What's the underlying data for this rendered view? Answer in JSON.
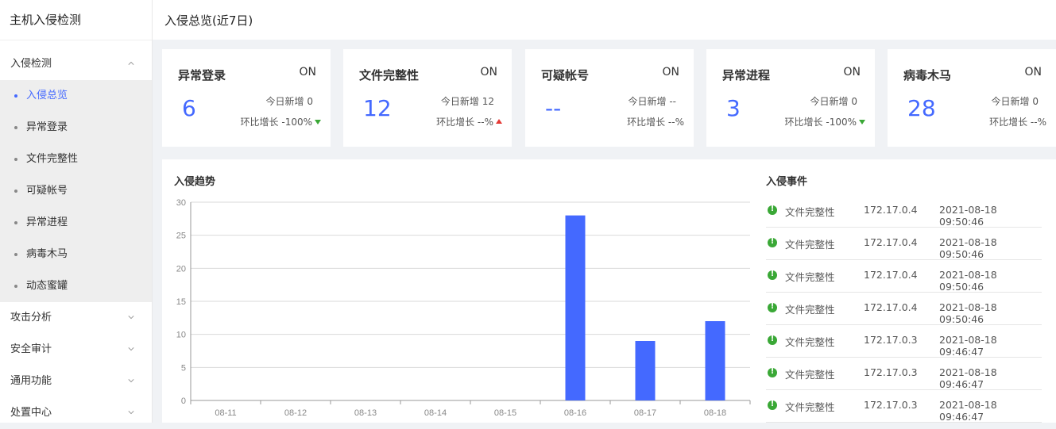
{
  "app": {
    "title": "主机入侵检测"
  },
  "header": {
    "title": "入侵总览(近7日)"
  },
  "sidebar": {
    "groups": [
      {
        "label": "入侵检测",
        "expanded": true
      },
      {
        "label": "攻击分析"
      },
      {
        "label": "安全审计"
      },
      {
        "label": "通用功能"
      },
      {
        "label": "处置中心"
      }
    ],
    "sub_items": [
      {
        "label": "入侵总览",
        "active": true
      },
      {
        "label": "异常登录"
      },
      {
        "label": "文件完整性"
      },
      {
        "label": "可疑帐号"
      },
      {
        "label": "异常进程"
      },
      {
        "label": "病毒木马"
      },
      {
        "label": "动态蜜罐"
      }
    ]
  },
  "cards": [
    {
      "title": "异常登录",
      "status": "ON",
      "value": "6",
      "today": "今日新增 0",
      "ratio": "环比增长 -100%",
      "trend": "down"
    },
    {
      "title": "文件完整性",
      "status": "ON",
      "value": "12",
      "today": "今日新增 12",
      "ratio": "环比增长 --%",
      "trend": "up"
    },
    {
      "title": "可疑帐号",
      "status": "ON",
      "value": "--",
      "today": "今日新增 --",
      "ratio": "环比增长 --%",
      "trend": "none"
    },
    {
      "title": "异常进程",
      "status": "ON",
      "value": "3",
      "today": "今日新增 0",
      "ratio": "环比增长 -100%",
      "trend": "down"
    },
    {
      "title": "病毒木马",
      "status": "ON",
      "value": "28",
      "today": "今日新增 0",
      "ratio": "环比增长 --%",
      "trend": "none"
    }
  ],
  "trend_chart": {
    "title": "入侵趋势"
  },
  "chart_data": {
    "type": "bar",
    "title": "入侵趋势",
    "categories": [
      "08-11",
      "08-12",
      "08-13",
      "08-14",
      "08-15",
      "08-16",
      "08-17",
      "08-18"
    ],
    "values": [
      0,
      0,
      0,
      0,
      0,
      28,
      9,
      12
    ],
    "ylim": [
      0,
      30
    ],
    "yticks": [
      0,
      5,
      10,
      15,
      20,
      25,
      30
    ],
    "grid": true,
    "bar_color": "#4469ff"
  },
  "events": {
    "title": "入侵事件",
    "rows": [
      {
        "type": "文件完整性",
        "ip": "172.17.0.4",
        "time": "2021-08-18 09:50:46"
      },
      {
        "type": "文件完整性",
        "ip": "172.17.0.4",
        "time": "2021-08-18 09:50:46"
      },
      {
        "type": "文件完整性",
        "ip": "172.17.0.4",
        "time": "2021-08-18 09:50:46"
      },
      {
        "type": "文件完整性",
        "ip": "172.17.0.4",
        "time": "2021-08-18 09:50:46"
      },
      {
        "type": "文件完整性",
        "ip": "172.17.0.3",
        "time": "2021-08-18 09:46:47"
      },
      {
        "type": "文件完整性",
        "ip": "172.17.0.3",
        "time": "2021-08-18 09:46:47"
      },
      {
        "type": "文件完整性",
        "ip": "172.17.0.3",
        "time": "2021-08-18 09:46:47"
      }
    ]
  },
  "colors": {
    "accent": "#4469ff",
    "ok": "#3aa836",
    "up": "#e53935"
  }
}
